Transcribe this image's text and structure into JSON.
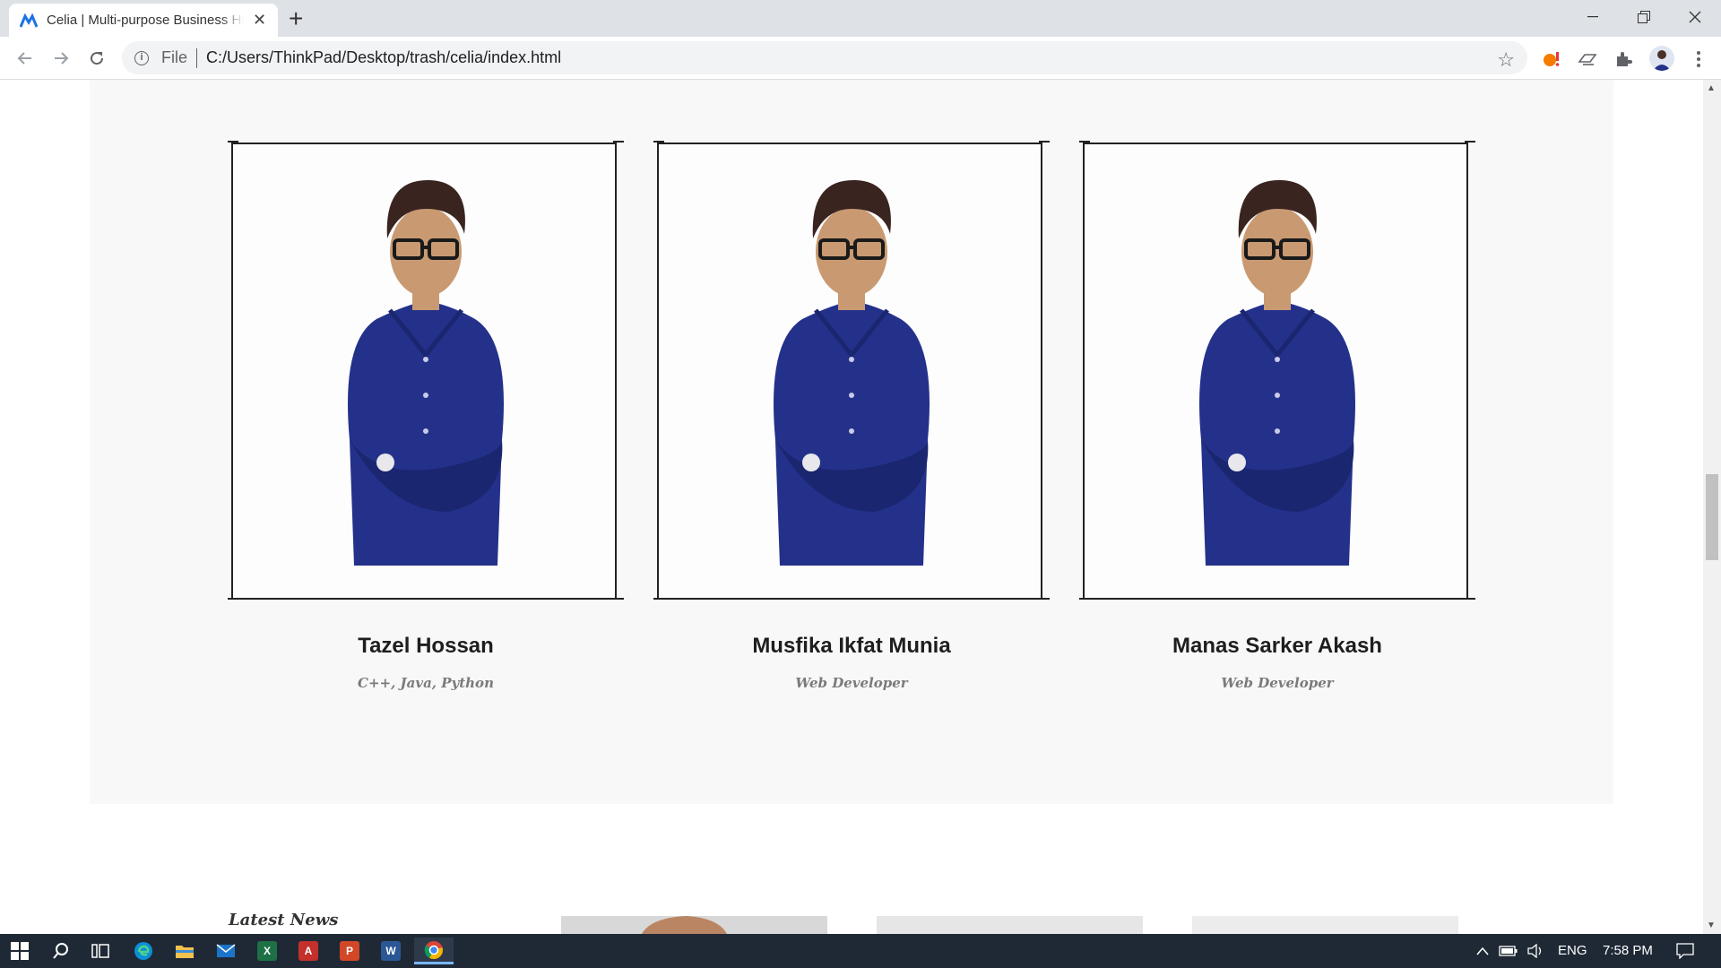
{
  "browser": {
    "tab_title": "Celia | Multi-purpose Business Hub",
    "file_label": "File",
    "url": "C:/Users/ThinkPad/Desktop/trash/celia/index.html"
  },
  "team": {
    "members": [
      {
        "name": "Tazel Hossan",
        "role": "C++, Java, Python"
      },
      {
        "name": "Musfika Ikfat Munia",
        "role": "Web Developer"
      },
      {
        "name": "Manas Sarker Akash",
        "role": "Web Developer"
      }
    ]
  },
  "news": {
    "label": "Latest News"
  },
  "taskbar": {
    "language": "ENG",
    "time": "7:58 PM"
  },
  "colors": {
    "shirt": "#24318a",
    "accent": "#1a73e8",
    "taskbar": "#1f2936"
  },
  "icons": [
    "back-arrow-icon",
    "forward-arrow-icon",
    "reload-icon",
    "info-icon",
    "star-icon",
    "extension-icon",
    "windows-start-icon",
    "search-icon",
    "task-view-icon",
    "edge-icon",
    "file-explorer-icon",
    "mail-icon",
    "excel-icon",
    "acrobat-icon",
    "powerpoint-icon",
    "word-icon",
    "chrome-icon",
    "chevron-up-icon",
    "battery-icon",
    "volume-icon",
    "notification-icon"
  ]
}
